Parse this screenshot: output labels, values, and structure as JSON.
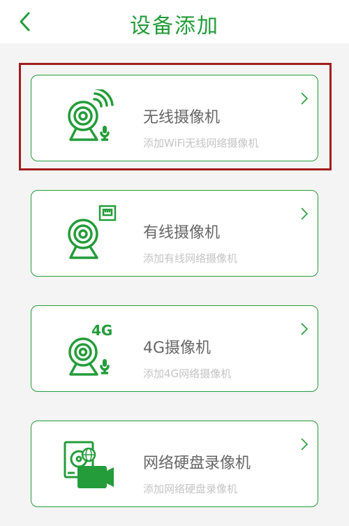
{
  "header": {
    "title": "设备添加",
    "back_icon": "chevron-left-icon"
  },
  "colors": {
    "brand_green": "#249c3a",
    "highlight_red": "#a11d1d",
    "name_text": "#666666",
    "desc_text": "#c4c4c4",
    "background": "#f4f4f4"
  },
  "devices": [
    {
      "name": "无线摄像机",
      "desc": "添加WiFi无线网络摄像机",
      "icon": "wifi-camera-icon",
      "highlighted": true
    },
    {
      "name": "有线摄像机",
      "desc": "添加有线网络摄像机",
      "icon": "wired-camera-icon"
    },
    {
      "name": "4G摄像机",
      "desc": "添加4G网络摄像机",
      "icon": "4g-camera-icon",
      "badge": "4G"
    },
    {
      "name": "网络硬盘录像机",
      "desc": "添加网络硬盘录像机",
      "icon": "nvr-icon"
    }
  ]
}
